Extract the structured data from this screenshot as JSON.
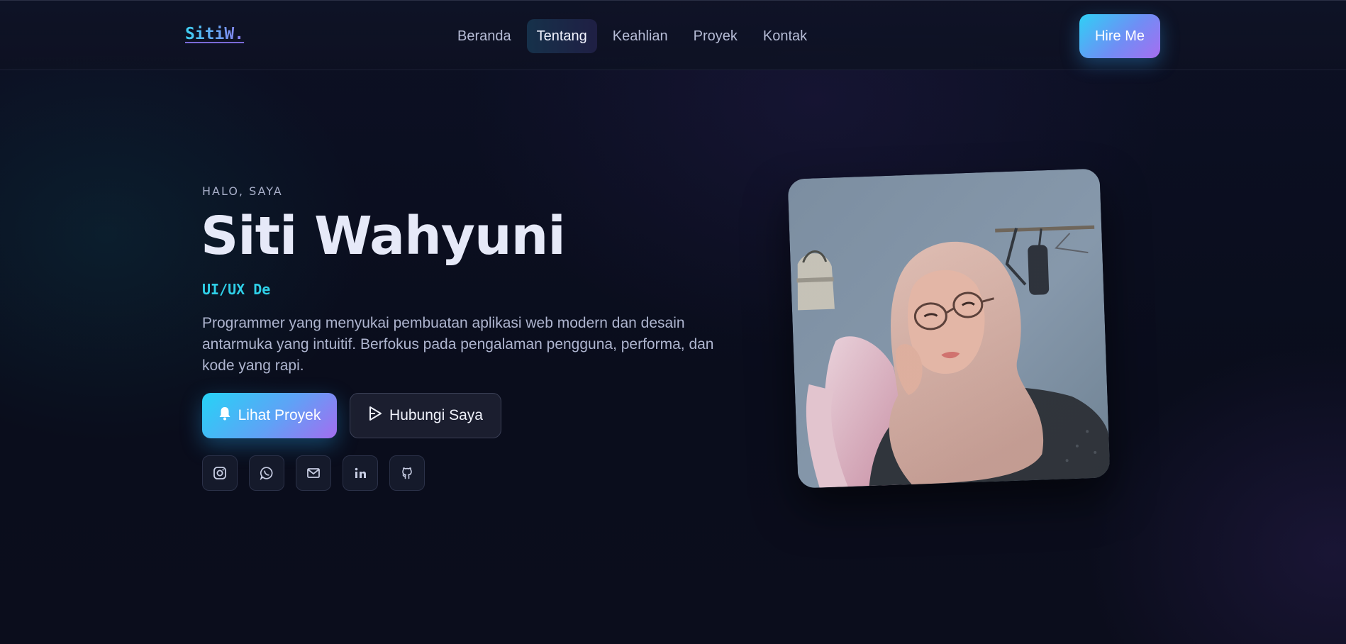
{
  "nav": {
    "logo": "SitiW.",
    "menu": [
      {
        "label": "Beranda",
        "active": false
      },
      {
        "label": "Tentang",
        "active": true
      },
      {
        "label": "Keahlian",
        "active": false
      },
      {
        "label": "Proyek",
        "active": false
      },
      {
        "label": "Kontak",
        "active": false
      }
    ],
    "hire_label": "Hire Me"
  },
  "hero": {
    "greeting": "HALO, SAYA",
    "name": "Siti Wahyuni",
    "role": "UI/UX De",
    "description": "Programmer yang menyukai pembuatan aplikasi web modern dan desain antarmuka yang intuitif. Berfokus pada pengalaman pengguna, performa, dan kode yang rapi.",
    "primary_button": {
      "label": "Lihat Proyek",
      "icon": "bell-icon"
    },
    "secondary_button": {
      "label": "Hubungi Saya",
      "icon": "send-icon"
    },
    "socials": [
      "instagram-icon",
      "whatsapp-icon",
      "email-icon",
      "linkedin-icon",
      "github-icon"
    ]
  },
  "colors": {
    "accent_cyan": "#2fd0f5",
    "accent_purple": "#a66df0",
    "background": "#0b0e1e"
  }
}
